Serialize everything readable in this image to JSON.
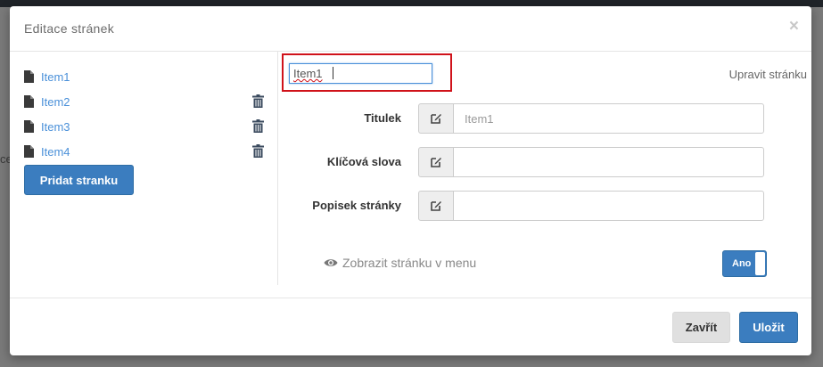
{
  "background": {
    "partial_text": "ce"
  },
  "modal": {
    "title": "Editace stránek",
    "close_glyph": "×"
  },
  "sidebar": {
    "items": [
      {
        "label": "Item1",
        "icon": "file-icon",
        "deletable": false
      },
      {
        "label": "Item2",
        "icon": "file-icon",
        "deletable": true
      },
      {
        "label": "Item3",
        "icon": "file-icon",
        "deletable": true
      },
      {
        "label": "Item4",
        "icon": "file-icon",
        "deletable": true
      }
    ],
    "add_button_label": "Pridat stranku"
  },
  "content": {
    "page_name_value": "Item1",
    "edit_link": "Upravit stránku",
    "fields": [
      {
        "label": "Titulek",
        "value": "",
        "placeholder": "Item1"
      },
      {
        "label": "Klíčová slova",
        "value": "",
        "placeholder": ""
      },
      {
        "label": "Popisek stránky",
        "value": "",
        "placeholder": ""
      }
    ],
    "menu_toggle_label": "Zobrazit stránku v menu",
    "menu_toggle_state": "Ano"
  },
  "footer": {
    "close_label": "Zavřít",
    "save_label": "Uložit"
  },
  "colors": {
    "primary": "#3b7dbf",
    "link": "#4a90d9",
    "highlight": "#d0121a"
  }
}
